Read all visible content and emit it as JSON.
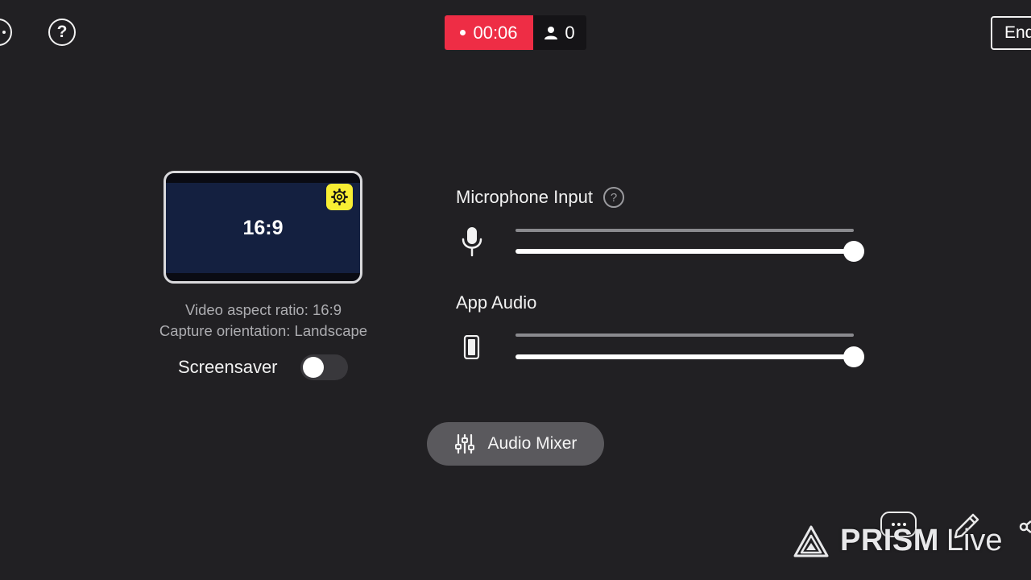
{
  "top_bar": {
    "help_glyph": "?",
    "timer": "00:06",
    "viewer_count": "0",
    "end_label": "End",
    "rec_color": "#ee2d45"
  },
  "preview": {
    "aspect_label": "16:9",
    "gear_color": "#f8ee33"
  },
  "info": {
    "aspect_ratio_text": "Video aspect ratio: 16:9",
    "orientation_text": "Capture orientation: Landscape"
  },
  "screensaver": {
    "label": "Screensaver",
    "enabled": false
  },
  "microphone": {
    "title": "Microphone Input",
    "help_glyph": "?",
    "volume": 1.0,
    "icon": "microphone-icon"
  },
  "app_audio": {
    "title": "App Audio",
    "volume": 1.0,
    "icon": "phone-icon"
  },
  "mixer": {
    "label": "Audio Mixer",
    "icon": "sliders-icon"
  },
  "watermark": {
    "brand": "PRISM",
    "suffix": "Live"
  }
}
